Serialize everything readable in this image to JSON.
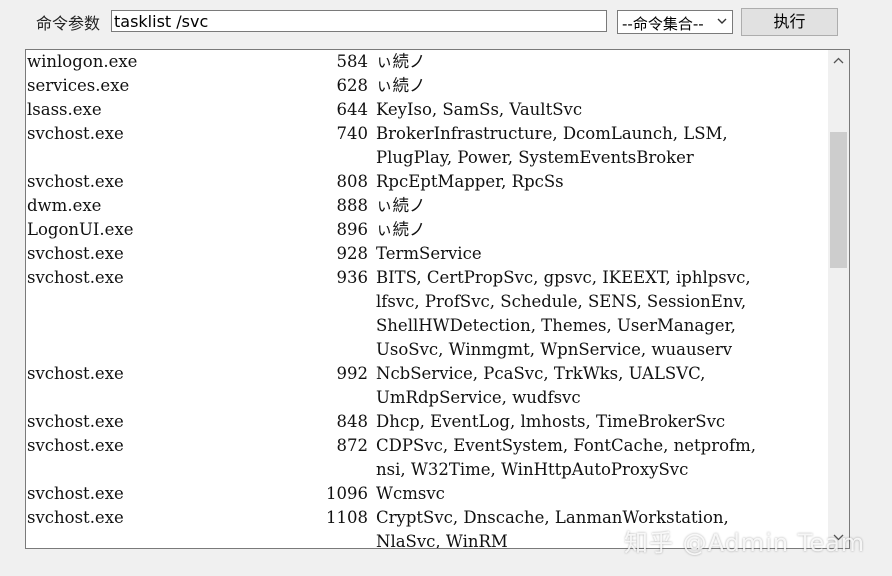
{
  "toolbar": {
    "command_label": "命令参数",
    "command_value": "tasklist /svc",
    "command_set_selected": "--命令集合--",
    "execute_label": "执行"
  },
  "output": {
    "rows": [
      {
        "name": "winlogon.exe",
        "pid": "584",
        "services": [
          "ぃ続ノ"
        ]
      },
      {
        "name": "services.exe",
        "pid": "628",
        "services": [
          "ぃ続ノ"
        ]
      },
      {
        "name": "lsass.exe",
        "pid": "644",
        "services": [
          "KeyIso, SamSs, VaultSvc"
        ]
      },
      {
        "name": "svchost.exe",
        "pid": "740",
        "services": [
          "BrokerInfrastructure, DcomLaunch, LSM,",
          "PlugPlay, Power, SystemEventsBroker"
        ]
      },
      {
        "name": "svchost.exe",
        "pid": "808",
        "services": [
          "RpcEptMapper, RpcSs"
        ]
      },
      {
        "name": "dwm.exe",
        "pid": "888",
        "services": [
          "ぃ続ノ"
        ]
      },
      {
        "name": "LogonUI.exe",
        "pid": "896",
        "services": [
          "ぃ続ノ"
        ]
      },
      {
        "name": "svchost.exe",
        "pid": "928",
        "services": [
          "TermService"
        ]
      },
      {
        "name": "svchost.exe",
        "pid": "936",
        "services": [
          "BITS, CertPropSvc, gpsvc, IKEEXT, iphlpsvc,",
          "lfsvc, ProfSvc, Schedule, SENS, SessionEnv,",
          "ShellHWDetection, Themes, UserManager,",
          "UsoSvc, Winmgmt, WpnService, wuauserv"
        ]
      },
      {
        "name": "svchost.exe",
        "pid": "992",
        "services": [
          "NcbService, PcaSvc, TrkWks, UALSVC,",
          "UmRdpService, wudfsvc"
        ]
      },
      {
        "name": "svchost.exe",
        "pid": "848",
        "services": [
          "Dhcp, EventLog, lmhosts, TimeBrokerSvc"
        ]
      },
      {
        "name": "svchost.exe",
        "pid": "872",
        "services": [
          "CDPSvc, EventSystem, FontCache, netprofm,",
          "nsi, W32Time, WinHttpAutoProxySvc"
        ]
      },
      {
        "name": "svchost.exe",
        "pid": "1096",
        "services": [
          "Wcmsvc"
        ]
      },
      {
        "name": "svchost.exe",
        "pid": "1108",
        "services": [
          "CryptSvc, Dnscache, LanmanWorkstation,",
          "NlaSvc, WinRM"
        ]
      }
    ]
  },
  "watermark": "知乎 @Admin Team",
  "colors": {
    "window_bg": "#f0f0f0",
    "panel_bg": "#ffffff",
    "border": "#7a7a7a",
    "button_bg": "#e1e1e1",
    "scroll_thumb": "#cdcdcd"
  }
}
